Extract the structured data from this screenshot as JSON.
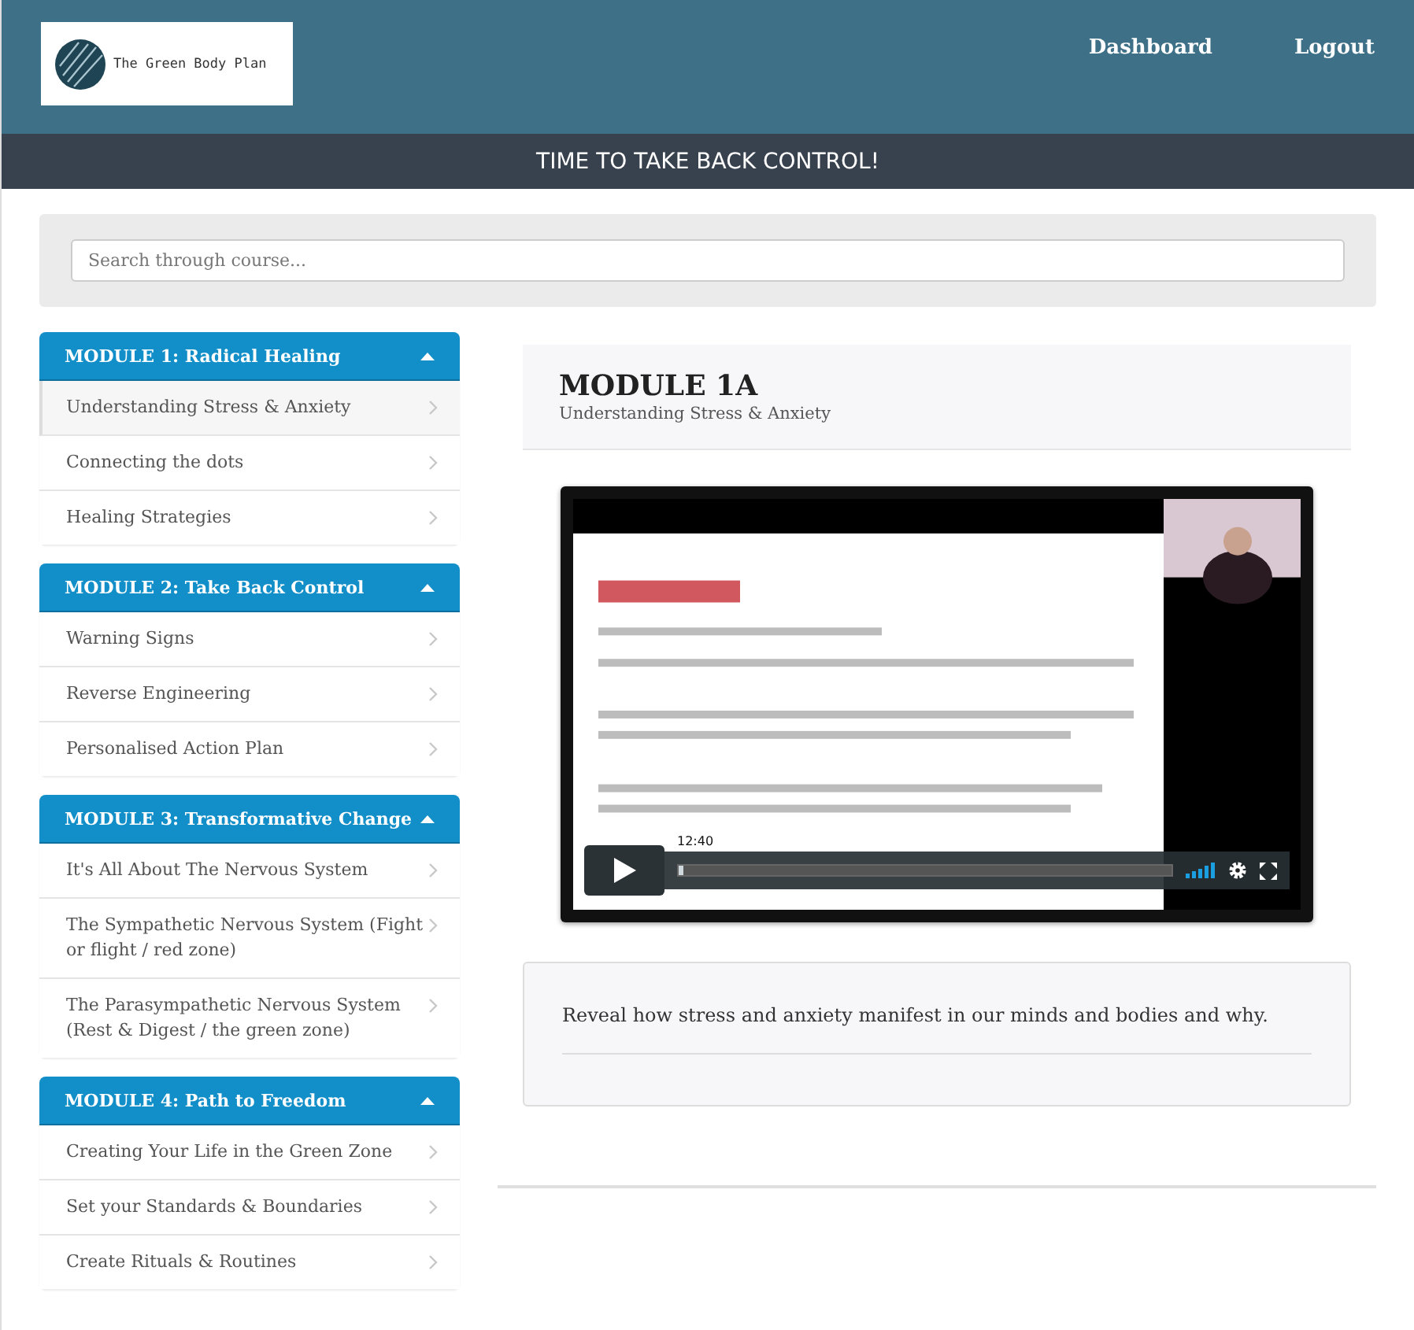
{
  "header": {
    "logo_text": "The Green Body Plan",
    "nav": [
      "Dashboard",
      "Logout"
    ]
  },
  "banner": "TIME TO TAKE BACK CONTROL!",
  "search": {
    "placeholder": "Search through course..."
  },
  "modules": [
    {
      "title": "MODULE 1: Radical Healing",
      "expanded": true,
      "lessons": [
        {
          "title": "Understanding Stress & Anxiety",
          "selected": true
        },
        {
          "title": "Connecting the dots",
          "selected": false
        },
        {
          "title": "Healing Strategies",
          "selected": false
        }
      ]
    },
    {
      "title": "MODULE 2: Take Back Control",
      "expanded": true,
      "lessons": [
        {
          "title": "Warning Signs",
          "selected": false
        },
        {
          "title": "Reverse Engineering",
          "selected": false
        },
        {
          "title": "Personalised Action Plan",
          "selected": false
        }
      ]
    },
    {
      "title": "MODULE 3: Transformative Change",
      "expanded": true,
      "lessons": [
        {
          "title": "It's All About The Nervous System",
          "selected": false
        },
        {
          "title": "The Sympathetic Nervous System (Fight or flight / red zone)",
          "selected": false
        },
        {
          "title": "The Parasympathetic Nervous System (Rest & Digest / the green zone)",
          "selected": false
        }
      ]
    },
    {
      "title": "MODULE 4: Path to Freedom",
      "expanded": true,
      "lessons": [
        {
          "title": "Creating Your Life in the Green Zone",
          "selected": false
        },
        {
          "title": "Set your Standards & Boundaries",
          "selected": false
        },
        {
          "title": "Create Rituals & Routines",
          "selected": false
        }
      ]
    }
  ],
  "lesson": {
    "title": "MODULE 1A",
    "subtitle": "Understanding Stress & Anxiety",
    "video": {
      "kind": "picture",
      "time": "12:40",
      "progress": {
        "level": 0.01
      }
    },
    "description": "Reveal how stress and anxiety manifest in our minds and bodies and why."
  }
}
